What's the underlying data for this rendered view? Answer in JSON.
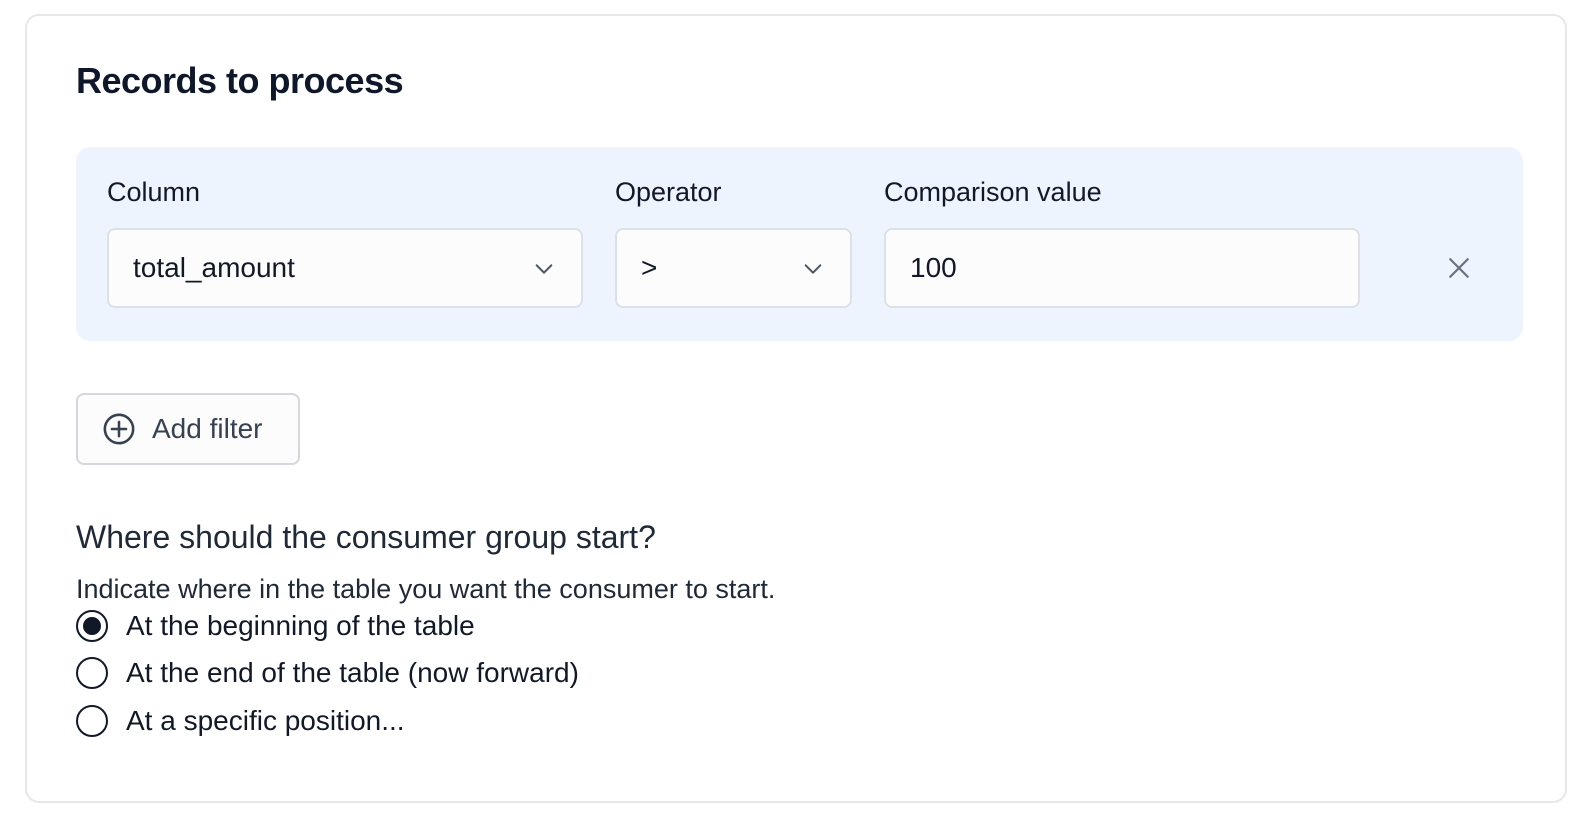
{
  "section": {
    "title": "Records to process"
  },
  "filter": {
    "column_label": "Column",
    "column_value": "total_amount",
    "operator_label": "Operator",
    "operator_value": ">",
    "comparison_label": "Comparison value",
    "comparison_value": "100"
  },
  "add_filter": {
    "label": "Add filter"
  },
  "start": {
    "question": "Where should the consumer group start?",
    "help": "Indicate where in the table you want the consumer to start.",
    "options": [
      {
        "label": "At the beginning of the table",
        "selected": true
      },
      {
        "label": "At the end of the table (now forward)",
        "selected": false
      },
      {
        "label": "At a specific position...",
        "selected": false
      }
    ]
  },
  "icons": {
    "chevron": "chevron-down-icon",
    "remove": "close-icon",
    "add": "plus-circle-icon"
  }
}
